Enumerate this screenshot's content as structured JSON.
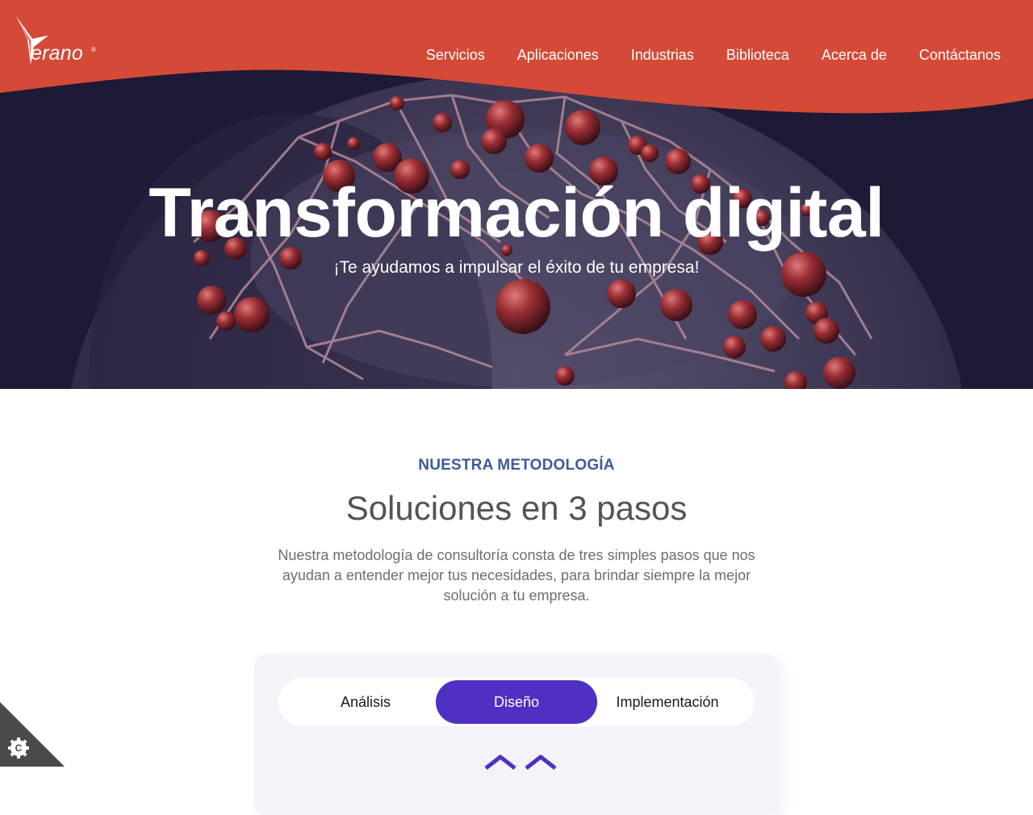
{
  "brand": {
    "logo_text": "erano",
    "logo_mark": "®",
    "colors": {
      "header": "#d44a37",
      "hero_bg": "#1e1a36",
      "accent": "#5030c2",
      "eyebrow": "#3a5c98"
    }
  },
  "nav": {
    "items": [
      "Servicios",
      "Aplicaciones",
      "Industrias",
      "Biblioteca",
      "Acerca de",
      "Contáctanos"
    ]
  },
  "hero": {
    "title": "Transformación digital",
    "subtitle": "¡Te ayudamos a impulsar el éxito de tu empresa!"
  },
  "methodology": {
    "eyebrow": "NUESTRA METODOLOGÍA",
    "title": "Soluciones en 3 pasos",
    "description": "Nuestra metodología de consultoría consta de tres simples pasos que nos ayudan a entender mejor tus necesidades, para brindar siempre la mejor solución a tu empresa.",
    "tabs": [
      "Análisis",
      "Diseño",
      "Implementación"
    ],
    "active_tab": "Diseño",
    "step_icon": "design-icon"
  },
  "cookie": {
    "icon": "cookie-settings-icon"
  }
}
